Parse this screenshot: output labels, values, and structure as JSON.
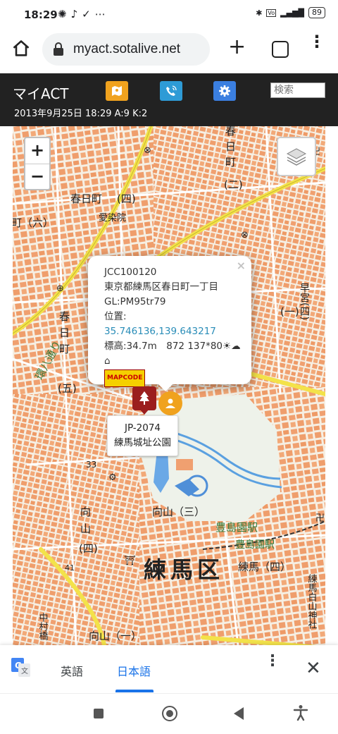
{
  "status_bar": {
    "time": "18:29",
    "notification_icons": [
      "pinwheel-icon",
      "tiktok-icon",
      "check-icon",
      "more-icon"
    ],
    "right_icons": [
      "bluetooth-icon",
      "volte-icon",
      "signal-4g-icon"
    ],
    "battery": "89"
  },
  "browser": {
    "url": "myact.sotalive.net",
    "icons": [
      "home-icon",
      "lock-icon",
      "plus-icon",
      "tabs-icon",
      "menu-icon"
    ]
  },
  "app_header": {
    "title": "マイACT",
    "subtitle": "2013年9月25日 18:29 A:9 K:2",
    "buttons": [
      {
        "icon": "map-icon",
        "color": "#f0a21e"
      },
      {
        "icon": "phone-wave-icon",
        "color": "#2e9bd6"
      },
      {
        "icon": "gear-icon",
        "color": "#3b7fe0"
      }
    ],
    "search_placeholder": "検索"
  },
  "map": {
    "zoom_in": "+",
    "zoom_out": "−",
    "labels": {
      "ward": "練馬区",
      "station1": "豊島園駅",
      "station2": "豊島園駅",
      "kasuga1": "春日町",
      "kasuga_num": "(四)",
      "kasuga2": "春",
      "kasuga3": "日",
      "kasuga4": "町",
      "kasuga5": "(五)",
      "machi6": "町（六）",
      "mukouyama1": "向",
      "mukouyama2": "山",
      "mukouyama3": "(四)",
      "mukouyama4": "向山（三）",
      "mukouyama5": "向山（一）",
      "nerima4": "練馬（四）",
      "hayamiya": "早宮(四)",
      "kasuga_right1": "春",
      "kasuga_right2": "日",
      "kasuga_right3": "町",
      "kasuga_right4": "(二)",
      "one": "(一)",
      "aizome": "愛染院",
      "nakamura": "中村橋",
      "shirayama": "練馬白山神社",
      "road_num": "33",
      "road_num2": "41",
      "hachi_dori": "環八通り"
    },
    "popup": {
      "id": "JCC100120",
      "address": "東京都練馬区春日町一丁目",
      "grid": "GL:PM95tr79",
      "position_label": "位置:",
      "coordinates": "35.746136,139.643217",
      "elevation": "標高:34.7m　872 137*80",
      "mapcode_label": "MAPCODE",
      "close": "×"
    },
    "tooltip": {
      "ref": "JP-2074",
      "name": "練馬城址公園"
    },
    "colors": {
      "building": "#f0a070",
      "road_major": "#f3e24a",
      "water": "#5aa0e0",
      "park": "#e8f0e4"
    }
  },
  "translate_bar": {
    "lang_source": "英語",
    "lang_target": "日本語",
    "active_color": "#1a73e8"
  },
  "nav_bar": {
    "icons": [
      "recents-icon",
      "home-icon",
      "back-icon",
      "accessibility-icon"
    ]
  }
}
